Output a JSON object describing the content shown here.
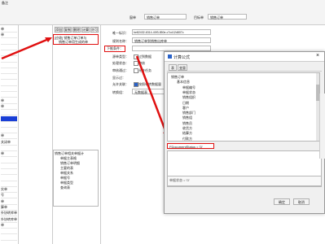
{
  "top": {
    "menu_fragment": "备注",
    "form_label": "窗单",
    "form_value": "销售订单",
    "object_label": "目标单",
    "object_value": "销售订单"
  },
  "left_list": {
    "items": [
      "单",
      "单",
      "",
      "",
      "",
      "",
      "",
      "",
      "",
      "",
      "",
      "",
      "单",
      "单",
      "",
      "",
      "",
      "",
      "单",
      "关闭单",
      "",
      "单",
      "",
      "",
      "",
      "",
      "",
      "实单",
      "号",
      "单",
      "算单",
      "外协转库单",
      "外协转库单",
      "单",
      "",
      ""
    ],
    "selected_index": 15
  },
  "toolbar": {
    "buttons": [
      "添加",
      "复制",
      "删除",
      "计算",
      "许可"
    ]
  },
  "rule_list": {
    "lines": [
      "[应收] 销售订单订单与",
      "销售订单用生成的单"
    ]
  },
  "form": {
    "unique_label": "唯一标识：",
    "unique_value": "be82432-6314-40f3-850e-c7cd12d807c",
    "rule_name_label": "规则名称：",
    "rule_name_value": "销售订单到销售出库单",
    "condition_label": "下推条件：",
    "source_label": "源单类型：",
    "process_label": "处理状态：",
    "approve_label": "审核通过：",
    "show_label": "显示过：",
    "allow_label": "允许关联：",
    "group_label": "转换组：",
    "group_value": "无数据表",
    "check_no_confirm": "过到数据",
    "check_mid": "审核",
    "check_allow": "允许任务",
    "check_display": "允许显示转数",
    "check_all": "按照单转数据量"
  },
  "bottom_list": {
    "lines": [
      "销售订单相关单据计",
      "单据主表格",
      "销售订单明细",
      "主要的表",
      "单据关系",
      "单据号",
      "单据类型",
      "查询表"
    ]
  },
  "dialog": {
    "title": "计算公式",
    "close": "×",
    "tabs": [
      "表",
      "变量"
    ],
    "tree": [
      {
        "text": "销售订单",
        "indent": 0
      },
      {
        "text": "基本信息",
        "indent": 1
      },
      {
        "text": "单据编号",
        "indent": 2
      },
      {
        "text": "单据状态",
        "indent": 2
      },
      {
        "text": "销售组织",
        "indent": 2
      },
      {
        "text": "日期",
        "indent": 2
      },
      {
        "text": "客户",
        "indent": 2
      },
      {
        "text": "销售部门",
        "indent": 2
      },
      {
        "text": "销售组",
        "indent": 2
      },
      {
        "text": "销售员",
        "indent": 2
      },
      {
        "text": "收货方",
        "indent": 2
      },
      {
        "text": "结算方",
        "indent": 2
      },
      {
        "text": "付款方",
        "indent": 2
      }
    ],
    "formula_value": "FDocumentStatus = 'D'",
    "preview_value": "单据状态 = 'D'",
    "ok_label": "确定",
    "cancel_label": "取消"
  },
  "colors": {
    "red": "#e01010",
    "selected": "#1a3fd6",
    "panel": "#eaeaea"
  }
}
